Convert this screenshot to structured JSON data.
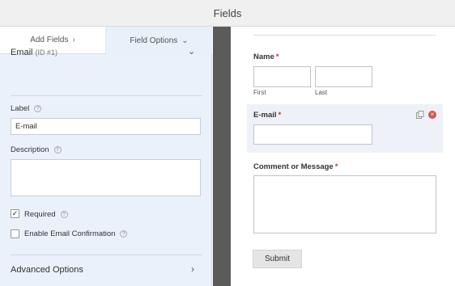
{
  "header": {
    "title": "Fields"
  },
  "tabs": [
    {
      "label": "Add Fields",
      "chevron": "›"
    },
    {
      "label": "Field Options",
      "chevron": "⌄"
    }
  ],
  "field_options": {
    "field_name": "Email",
    "field_id": "(ID #1)",
    "label_label": "Label",
    "label_value": "E-mail",
    "description_label": "Description",
    "description_value": "",
    "required_label": "Required",
    "required_checked": true,
    "confirmation_label": "Enable Email Confirmation",
    "confirmation_checked": false,
    "advanced_label": "Advanced Options"
  },
  "preview": {
    "name_label": "Name",
    "first_sublabel": "First",
    "last_sublabel": "Last",
    "email_label": "E-mail",
    "comment_label": "Comment or Message",
    "required_marker": "*",
    "submit_label": "Submit"
  },
  "colors": {
    "accent_panel": "#eaf1fb",
    "required": "#c0392b",
    "gutter": "#5b5b5b",
    "delete": "#d9534f"
  },
  "icons": [
    "help-icon",
    "chevron-down-icon",
    "chevron-right-icon",
    "checkmark-icon",
    "duplicate-icon",
    "delete-icon"
  ]
}
